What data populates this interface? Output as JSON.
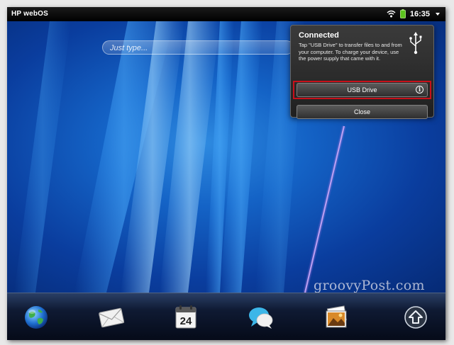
{
  "statusbar": {
    "title": "HP webOS",
    "time": "16:35"
  },
  "search": {
    "placeholder": "Just type..."
  },
  "notification": {
    "title": "Connected",
    "message": "Tap \"USB Drive\" to transfer files to and from your computer. To charge your device, use the power supply that came with it.",
    "primary_button": "USB Drive",
    "info_glyph": "i",
    "secondary_button": "Close"
  },
  "watermark": "groovyPost.com",
  "dock": {
    "icons": [
      "globe-icon",
      "mail-icon",
      "calendar-icon",
      "messaging-icon",
      "photos-icon",
      "launcher-up-icon"
    ],
    "calendar_day": "24"
  },
  "colors": {
    "highlight": "#c8101a",
    "accent_purple": "#c9a6f0"
  }
}
